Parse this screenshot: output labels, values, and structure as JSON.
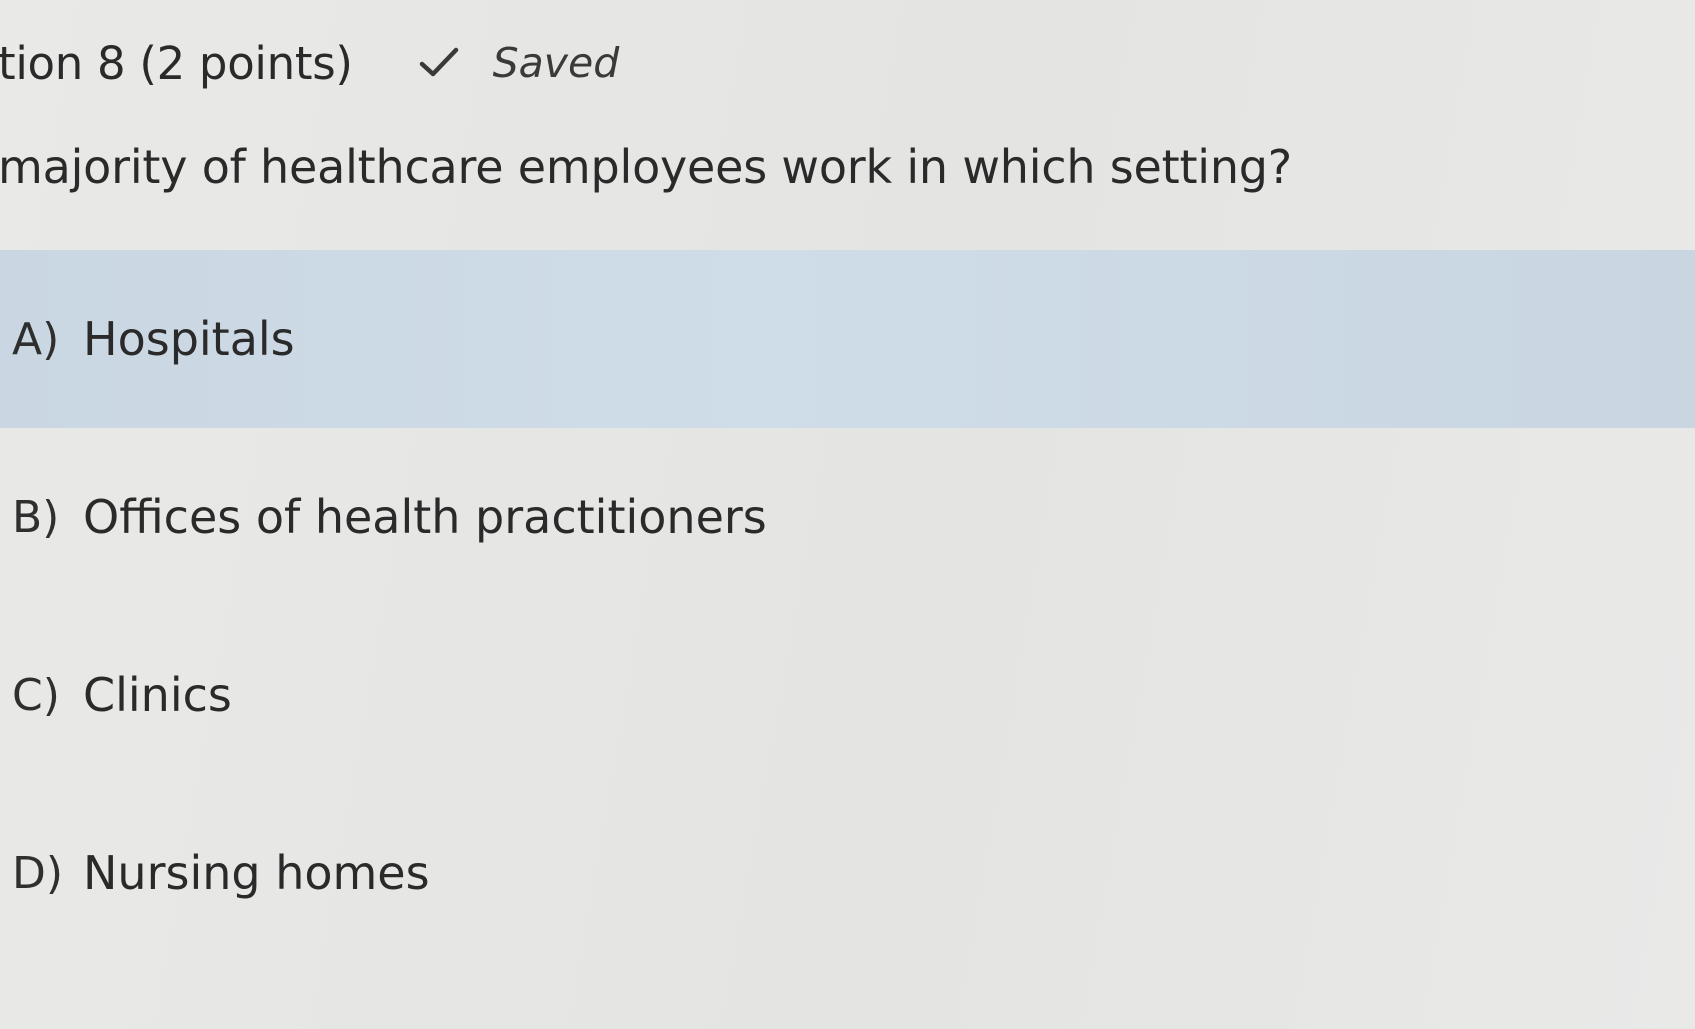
{
  "header": {
    "question_title": "tion 8 (2 points)",
    "status_icon": "check-icon",
    "status_text": "Saved"
  },
  "question": {
    "text": "majority of healthcare employees work in which setting?"
  },
  "choices": [
    {
      "letter": "A)",
      "label": "Hospitals",
      "selected": true
    },
    {
      "letter": "B)",
      "label": "Offices of health practitioners",
      "selected": false
    },
    {
      "letter": "C)",
      "label": "Clinics",
      "selected": false
    },
    {
      "letter": "D)",
      "label": "Nursing homes",
      "selected": false
    }
  ],
  "colors": {
    "background": "#e6e6e4",
    "selected_row": "#cddae6",
    "text": "#2a2a2a"
  }
}
